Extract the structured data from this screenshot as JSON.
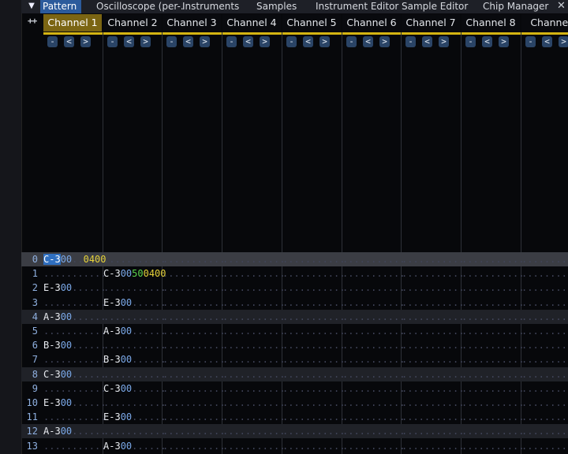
{
  "tabs": [
    {
      "label": "Pattern",
      "active": true
    },
    {
      "label": "Oscilloscope (per-.",
      "active": false
    },
    {
      "label": "Instruments",
      "active": false
    },
    {
      "label": "Samples",
      "active": false
    },
    {
      "label": "Instrument Editor",
      "active": false
    },
    {
      "label": "Sample Editor",
      "active": false
    },
    {
      "label": "Chip Manager",
      "active": false
    }
  ],
  "menu_icon": "triangle-down",
  "close_icon": "close-x",
  "expand_label": "++",
  "channels": [
    {
      "name": "Channel 1",
      "selected": true
    },
    {
      "name": "Channel 2",
      "selected": false
    },
    {
      "name": "Channel 3",
      "selected": false
    },
    {
      "name": "Channel 4",
      "selected": false
    },
    {
      "name": "Channel 5",
      "selected": false
    },
    {
      "name": "Channel 6",
      "selected": false
    },
    {
      "name": "Channel 7",
      "selected": false
    },
    {
      "name": "Channel 8",
      "selected": false
    },
    {
      "name": "Channel",
      "selected": false
    }
  ],
  "channel_buttons": [
    "-",
    "<",
    ">"
  ],
  "rows": [
    {
      "num": "0",
      "cells": [
        [
          "C-3",
          "00",
          "..",
          "0400"
        ],
        null,
        null,
        null,
        null,
        null,
        null,
        null,
        null
      ]
    },
    {
      "num": "1",
      "cells": [
        null,
        [
          "C-3",
          "00",
          "50",
          "0400"
        ],
        null,
        null,
        null,
        null,
        null,
        null,
        null
      ]
    },
    {
      "num": "2",
      "cells": [
        [
          "E-3",
          "00",
          "",
          ""
        ],
        null,
        null,
        null,
        null,
        null,
        null,
        null,
        null
      ]
    },
    {
      "num": "3",
      "cells": [
        null,
        [
          "E-3",
          "00",
          "",
          ""
        ],
        null,
        null,
        null,
        null,
        null,
        null,
        null
      ]
    },
    {
      "num": "4",
      "cells": [
        [
          "A-3",
          "00",
          "",
          ""
        ],
        null,
        null,
        null,
        null,
        null,
        null,
        null,
        null
      ]
    },
    {
      "num": "5",
      "cells": [
        null,
        [
          "A-3",
          "00",
          "",
          ""
        ],
        null,
        null,
        null,
        null,
        null,
        null,
        null
      ]
    },
    {
      "num": "6",
      "cells": [
        [
          "B-3",
          "00",
          "",
          ""
        ],
        null,
        null,
        null,
        null,
        null,
        null,
        null,
        null
      ]
    },
    {
      "num": "7",
      "cells": [
        null,
        [
          "B-3",
          "00",
          "",
          ""
        ],
        null,
        null,
        null,
        null,
        null,
        null,
        null
      ]
    },
    {
      "num": "8",
      "cells": [
        [
          "C-3",
          "00",
          "",
          ""
        ],
        null,
        null,
        null,
        null,
        null,
        null,
        null,
        null
      ]
    },
    {
      "num": "9",
      "cells": [
        null,
        [
          "C-3",
          "00",
          "",
          ""
        ],
        null,
        null,
        null,
        null,
        null,
        null,
        null
      ]
    },
    {
      "num": "10",
      "cells": [
        [
          "E-3",
          "00",
          "",
          ""
        ],
        null,
        null,
        null,
        null,
        null,
        null,
        null,
        null
      ]
    },
    {
      "num": "11",
      "cells": [
        null,
        [
          "E-3",
          "00",
          "",
          ""
        ],
        null,
        null,
        null,
        null,
        null,
        null,
        null
      ]
    },
    {
      "num": "12",
      "cells": [
        [
          "A-3",
          "00",
          "",
          ""
        ],
        null,
        null,
        null,
        null,
        null,
        null,
        null,
        null
      ]
    },
    {
      "num": "13",
      "cells": [
        null,
        [
          "A-3",
          "00",
          "",
          ""
        ],
        null,
        null,
        null,
        null,
        null,
        null,
        null
      ]
    }
  ],
  "empty_cell": "...........",
  "colors": {
    "accent": "#2c5b9c",
    "selected_channel": "#7b6513",
    "channel_underline": "#d4b412",
    "effect": "#e7d33a",
    "volume": "#5cd44c",
    "instrument": "#7aa8e8"
  }
}
